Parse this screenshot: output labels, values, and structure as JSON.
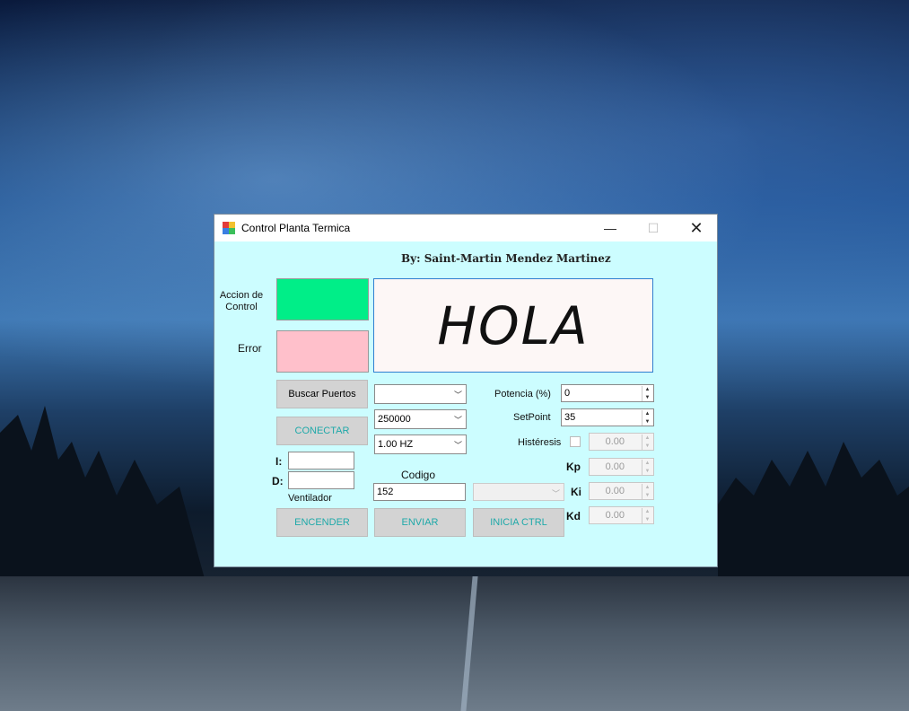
{
  "window": {
    "title": "Control Planta Termica"
  },
  "byline": "By: Saint-Martin Mendez Martinez",
  "labels": {
    "accion_control": "Accion de Control",
    "error": "Error",
    "i": "I:",
    "d": "D:",
    "ventilador": "Ventilador",
    "codigo": "Codigo",
    "potencia": "Potencia (%)",
    "setpoint": "SetPoint",
    "histeresis": "Histéresis",
    "kp": "Kp",
    "ki": "Ki",
    "kd": "Kd"
  },
  "display_text": "HOLA",
  "colors": {
    "accion_control": "#00ee88",
    "error": "#ffc0cb",
    "window_bg": "#ccfdff",
    "accent_text": "#1fa9a9"
  },
  "buttons": {
    "buscar_puertos": "Buscar Puertos",
    "conectar": "CONECTAR",
    "encender": "ENCENDER",
    "enviar": "ENVIAR",
    "inicia_ctrl": "INICIA CTRL"
  },
  "combos": {
    "port": "",
    "baud": "250000",
    "freq": "1.00 HZ",
    "ctrl_mode": ""
  },
  "inputs": {
    "i": "",
    "d": "",
    "codigo": "152"
  },
  "spinners": {
    "potencia": "0",
    "setpoint": "35",
    "histeresis": "0.00",
    "kp": "0.00",
    "ki": "0.00",
    "kd": "0.00"
  },
  "checkbox": {
    "histeresis_checked": false
  }
}
